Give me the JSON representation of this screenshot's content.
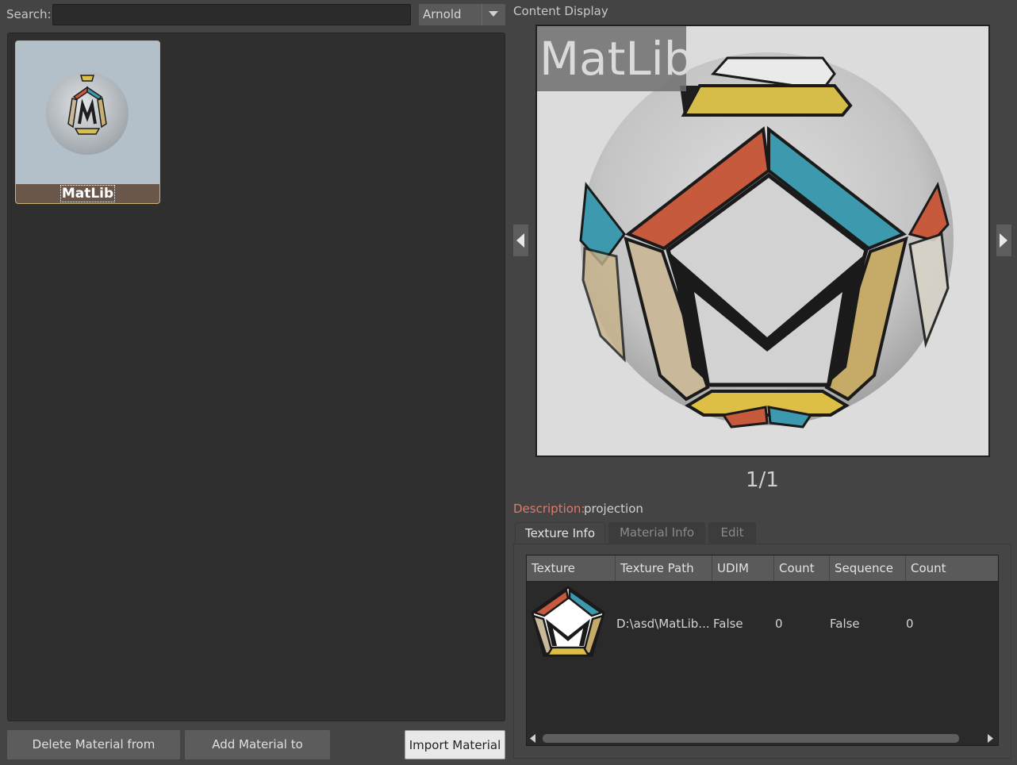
{
  "search": {
    "label": "Search:",
    "value": "",
    "placeholder": ""
  },
  "renderer": {
    "selected": "Arnold"
  },
  "grid": {
    "materials": [
      {
        "name": "MatLib"
      }
    ]
  },
  "buttons": {
    "delete": "Delete Material from Category",
    "add": "Add Material to Category",
    "import": "Import Material"
  },
  "content": {
    "title": "Content Display",
    "preview_label": "MatLib",
    "page": "1/1",
    "description_label": "Description:",
    "description_value": "projection"
  },
  "tabs": [
    {
      "label": "Texture Info",
      "active": true
    },
    {
      "label": "Material Info",
      "active": false
    },
    {
      "label": "Edit",
      "active": false
    }
  ],
  "table": {
    "columns": [
      "Texture",
      "Texture Path",
      "UDIM",
      "Count",
      "Sequence",
      "Count"
    ],
    "rows": [
      {
        "texture": "",
        "path": "D:\\asd\\MatLib...",
        "udim": "False",
        "count": "0",
        "sequence": "False",
        "count2": "0"
      }
    ]
  },
  "colors": {
    "accent_desc": "#e07a6a",
    "tile_border": "#c9b47a",
    "name_bar": "#6b5749"
  }
}
